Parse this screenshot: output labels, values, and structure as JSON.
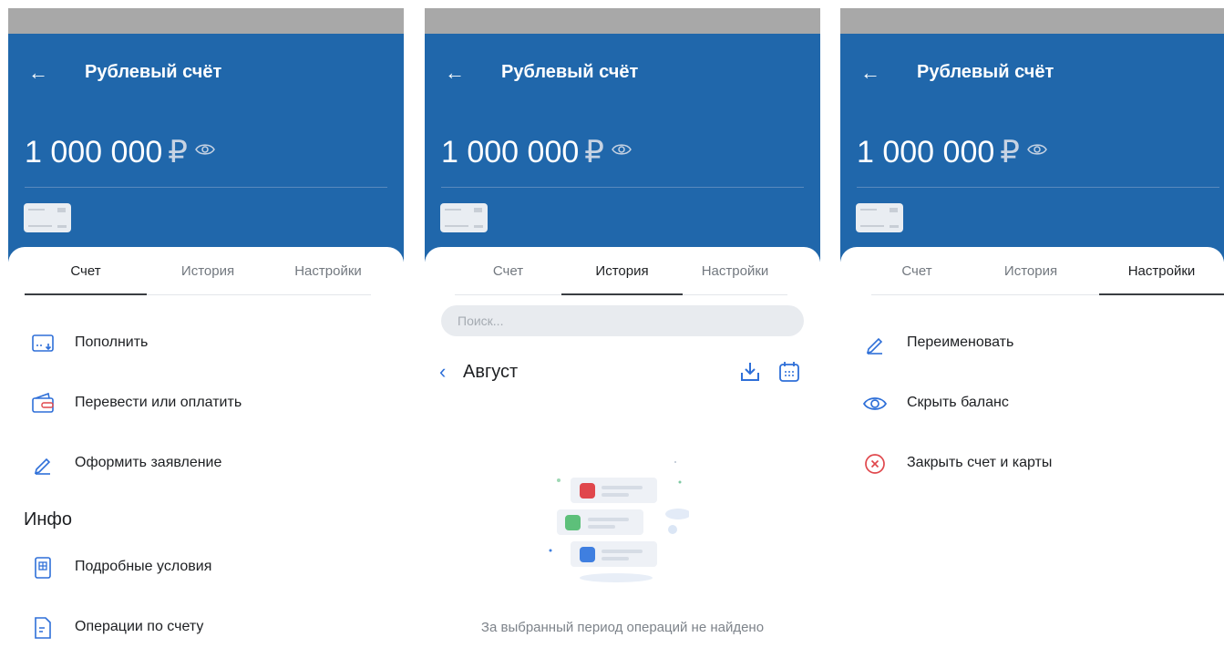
{
  "app": {
    "title": "Рублевый счёт",
    "balance": "1 000 000",
    "currency": "₽",
    "back_glyph": "←"
  },
  "tabs": [
    "Счет",
    "История",
    "Настройки"
  ],
  "screen_account": {
    "active_tab": "Счет",
    "actions": [
      {
        "label": "Пополнить",
        "icon": "top-up-icon"
      },
      {
        "label": "Перевести или оплатить",
        "icon": "wallet-icon"
      },
      {
        "label": "Оформить заявление",
        "icon": "pencil-icon"
      }
    ],
    "info_title": "Инфо",
    "info_items": [
      {
        "label": "Подробные условия",
        "icon": "document-grid-icon"
      },
      {
        "label": "Операции по счету",
        "icon": "document-icon"
      }
    ]
  },
  "screen_history": {
    "active_tab": "История",
    "search_placeholder": "Поиск...",
    "month": "Август",
    "empty_message": "За выбранный период операций не найдено"
  },
  "screen_settings": {
    "active_tab": "Настройки",
    "items": [
      {
        "label": "Переименовать",
        "icon": "pencil-icon"
      },
      {
        "label": "Скрыть баланс",
        "icon": "eye-icon"
      },
      {
        "label": "Закрыть счет и карты",
        "icon": "close-circle-icon"
      }
    ]
  },
  "colors": {
    "header_bg": "#2067ab",
    "accent": "#2e6fd8",
    "danger": "#e0474c"
  }
}
